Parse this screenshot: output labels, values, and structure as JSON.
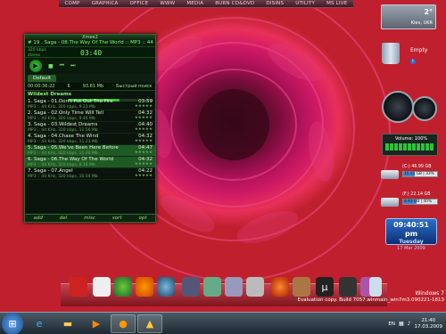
{
  "top_menu": [
    "COMP",
    "GRAPHICA",
    "OFFICE",
    "WWW",
    "MEDIA",
    "BURN CD&DVD",
    "DISINS",
    "UTILITY",
    "MS LIVE"
  ],
  "player": {
    "title": "Xmee2",
    "track_line": "# 19 . Saga - 08.The Way Of The World  ::  MP3 :: 44 Kh",
    "time": "03:40",
    "kbps": "320 kbps",
    "stereo": "stereo",
    "tab": "Default",
    "info_time": "00:00:36:22",
    "info_count": "6",
    "info_size": "93.81 Mb",
    "info_mode": "Быстрый поиск",
    "group": "Wildest Dreams",
    "tracks": [
      {
        "n": "1. Saga - 01.Don't Put Out The Fire",
        "m": "MP3 :: 44 KHz, 320 kbps, 9.23 Mb",
        "d": "03:59",
        "r": "★★★★★"
      },
      {
        "n": "2. Saga - 02.Only Time Will Tell",
        "m": "MP3 :: 44 KHz, 320 kbps, 9.46 Mb",
        "d": "04:32",
        "r": "★★★★★"
      },
      {
        "n": "3. Saga - 03.Wildest Dreams",
        "m": "MP3 :: 44 KHz, 320 kbps, 11.56 Mb",
        "d": "04:40",
        "r": "★★★★★"
      },
      {
        "n": "4. Saga - 04.Chase The Wind",
        "m": "MP3 :: 44 KHz, 320 kbps, 11.23 Mb",
        "d": "04:32",
        "r": "★★★★★"
      },
      {
        "n": "5. Saga - 05.We've Been Here Before",
        "m": "MP3 :: 44 KHz, 320 kbps, 11.00 Mb",
        "d": "04:47",
        "r": "★★★★★"
      },
      {
        "n": "6. Saga - 06.The Way Of The World",
        "m": "MP3 :: 44 KHz, 320 kbps, 8.16 Mb",
        "d": "04:32",
        "r": "★★★★★"
      },
      {
        "n": "7. Saga - 07.Angel",
        "m": "MP3 :: 44 KHz, 320 kbps, 10.04 Mb",
        "d": "04:22",
        "r": "★★★★★"
      }
    ],
    "bottom": [
      "add",
      "del",
      "misc",
      "sort",
      "opt"
    ],
    "progress": 0.6
  },
  "weather": {
    "temp": "2°",
    "city": "Kiev, UKR"
  },
  "recycle": {
    "label": "Empty"
  },
  "volume": {
    "label": "Volume: 100%"
  },
  "drives": [
    {
      "a": "(C:) 46.99 GB",
      "b": "15.51 GB | 33%",
      "fill": 0.33
    },
    {
      "a": "(F:) 22.14 GB",
      "b": "8.93 GB | 40%",
      "fill": 0.4
    }
  ],
  "clock": {
    "time": "09:40:51 pm",
    "day": "Tuesday",
    "date": "17 Mar 2009"
  },
  "watermark": {
    "l1": "Windows 7",
    "l2": "Evaluation copy. Build 7057.winmain_win7m3.090221-1813"
  },
  "taskbar": {
    "lang": "EN",
    "time": "21:40",
    "date": "17.03.2009"
  },
  "colors": {
    "accent": "#3fbf3a",
    "clock_bg": "#1b4fa0"
  }
}
